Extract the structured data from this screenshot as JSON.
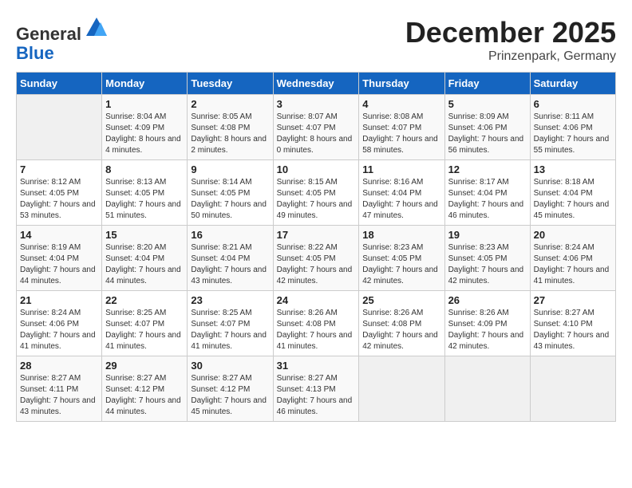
{
  "header": {
    "logo_general": "General",
    "logo_blue": "Blue",
    "month_title": "December 2025",
    "location": "Prinzenpark, Germany"
  },
  "days_of_week": [
    "Sunday",
    "Monday",
    "Tuesday",
    "Wednesday",
    "Thursday",
    "Friday",
    "Saturday"
  ],
  "weeks": [
    [
      {
        "day": "",
        "sunrise": "",
        "sunset": "",
        "daylight": ""
      },
      {
        "day": "1",
        "sunrise": "Sunrise: 8:04 AM",
        "sunset": "Sunset: 4:09 PM",
        "daylight": "Daylight: 8 hours and 4 minutes."
      },
      {
        "day": "2",
        "sunrise": "Sunrise: 8:05 AM",
        "sunset": "Sunset: 4:08 PM",
        "daylight": "Daylight: 8 hours and 2 minutes."
      },
      {
        "day": "3",
        "sunrise": "Sunrise: 8:07 AM",
        "sunset": "Sunset: 4:07 PM",
        "daylight": "Daylight: 8 hours and 0 minutes."
      },
      {
        "day": "4",
        "sunrise": "Sunrise: 8:08 AM",
        "sunset": "Sunset: 4:07 PM",
        "daylight": "Daylight: 7 hours and 58 minutes."
      },
      {
        "day": "5",
        "sunrise": "Sunrise: 8:09 AM",
        "sunset": "Sunset: 4:06 PM",
        "daylight": "Daylight: 7 hours and 56 minutes."
      },
      {
        "day": "6",
        "sunrise": "Sunrise: 8:11 AM",
        "sunset": "Sunset: 4:06 PM",
        "daylight": "Daylight: 7 hours and 55 minutes."
      }
    ],
    [
      {
        "day": "7",
        "sunrise": "Sunrise: 8:12 AM",
        "sunset": "Sunset: 4:05 PM",
        "daylight": "Daylight: 7 hours and 53 minutes."
      },
      {
        "day": "8",
        "sunrise": "Sunrise: 8:13 AM",
        "sunset": "Sunset: 4:05 PM",
        "daylight": "Daylight: 7 hours and 51 minutes."
      },
      {
        "day": "9",
        "sunrise": "Sunrise: 8:14 AM",
        "sunset": "Sunset: 4:05 PM",
        "daylight": "Daylight: 7 hours and 50 minutes."
      },
      {
        "day": "10",
        "sunrise": "Sunrise: 8:15 AM",
        "sunset": "Sunset: 4:05 PM",
        "daylight": "Daylight: 7 hours and 49 minutes."
      },
      {
        "day": "11",
        "sunrise": "Sunrise: 8:16 AM",
        "sunset": "Sunset: 4:04 PM",
        "daylight": "Daylight: 7 hours and 47 minutes."
      },
      {
        "day": "12",
        "sunrise": "Sunrise: 8:17 AM",
        "sunset": "Sunset: 4:04 PM",
        "daylight": "Daylight: 7 hours and 46 minutes."
      },
      {
        "day": "13",
        "sunrise": "Sunrise: 8:18 AM",
        "sunset": "Sunset: 4:04 PM",
        "daylight": "Daylight: 7 hours and 45 minutes."
      }
    ],
    [
      {
        "day": "14",
        "sunrise": "Sunrise: 8:19 AM",
        "sunset": "Sunset: 4:04 PM",
        "daylight": "Daylight: 7 hours and 44 minutes."
      },
      {
        "day": "15",
        "sunrise": "Sunrise: 8:20 AM",
        "sunset": "Sunset: 4:04 PM",
        "daylight": "Daylight: 7 hours and 44 minutes."
      },
      {
        "day": "16",
        "sunrise": "Sunrise: 8:21 AM",
        "sunset": "Sunset: 4:04 PM",
        "daylight": "Daylight: 7 hours and 43 minutes."
      },
      {
        "day": "17",
        "sunrise": "Sunrise: 8:22 AM",
        "sunset": "Sunset: 4:05 PM",
        "daylight": "Daylight: 7 hours and 42 minutes."
      },
      {
        "day": "18",
        "sunrise": "Sunrise: 8:23 AM",
        "sunset": "Sunset: 4:05 PM",
        "daylight": "Daylight: 7 hours and 42 minutes."
      },
      {
        "day": "19",
        "sunrise": "Sunrise: 8:23 AM",
        "sunset": "Sunset: 4:05 PM",
        "daylight": "Daylight: 7 hours and 42 minutes."
      },
      {
        "day": "20",
        "sunrise": "Sunrise: 8:24 AM",
        "sunset": "Sunset: 4:06 PM",
        "daylight": "Daylight: 7 hours and 41 minutes."
      }
    ],
    [
      {
        "day": "21",
        "sunrise": "Sunrise: 8:24 AM",
        "sunset": "Sunset: 4:06 PM",
        "daylight": "Daylight: 7 hours and 41 minutes."
      },
      {
        "day": "22",
        "sunrise": "Sunrise: 8:25 AM",
        "sunset": "Sunset: 4:07 PM",
        "daylight": "Daylight: 7 hours and 41 minutes."
      },
      {
        "day": "23",
        "sunrise": "Sunrise: 8:25 AM",
        "sunset": "Sunset: 4:07 PM",
        "daylight": "Daylight: 7 hours and 41 minutes."
      },
      {
        "day": "24",
        "sunrise": "Sunrise: 8:26 AM",
        "sunset": "Sunset: 4:08 PM",
        "daylight": "Daylight: 7 hours and 41 minutes."
      },
      {
        "day": "25",
        "sunrise": "Sunrise: 8:26 AM",
        "sunset": "Sunset: 4:08 PM",
        "daylight": "Daylight: 7 hours and 42 minutes."
      },
      {
        "day": "26",
        "sunrise": "Sunrise: 8:26 AM",
        "sunset": "Sunset: 4:09 PM",
        "daylight": "Daylight: 7 hours and 42 minutes."
      },
      {
        "day": "27",
        "sunrise": "Sunrise: 8:27 AM",
        "sunset": "Sunset: 4:10 PM",
        "daylight": "Daylight: 7 hours and 43 minutes."
      }
    ],
    [
      {
        "day": "28",
        "sunrise": "Sunrise: 8:27 AM",
        "sunset": "Sunset: 4:11 PM",
        "daylight": "Daylight: 7 hours and 43 minutes."
      },
      {
        "day": "29",
        "sunrise": "Sunrise: 8:27 AM",
        "sunset": "Sunset: 4:12 PM",
        "daylight": "Daylight: 7 hours and 44 minutes."
      },
      {
        "day": "30",
        "sunrise": "Sunrise: 8:27 AM",
        "sunset": "Sunset: 4:12 PM",
        "daylight": "Daylight: 7 hours and 45 minutes."
      },
      {
        "day": "31",
        "sunrise": "Sunrise: 8:27 AM",
        "sunset": "Sunset: 4:13 PM",
        "daylight": "Daylight: 7 hours and 46 minutes."
      },
      {
        "day": "",
        "sunrise": "",
        "sunset": "",
        "daylight": ""
      },
      {
        "day": "",
        "sunrise": "",
        "sunset": "",
        "daylight": ""
      },
      {
        "day": "",
        "sunrise": "",
        "sunset": "",
        "daylight": ""
      }
    ]
  ]
}
